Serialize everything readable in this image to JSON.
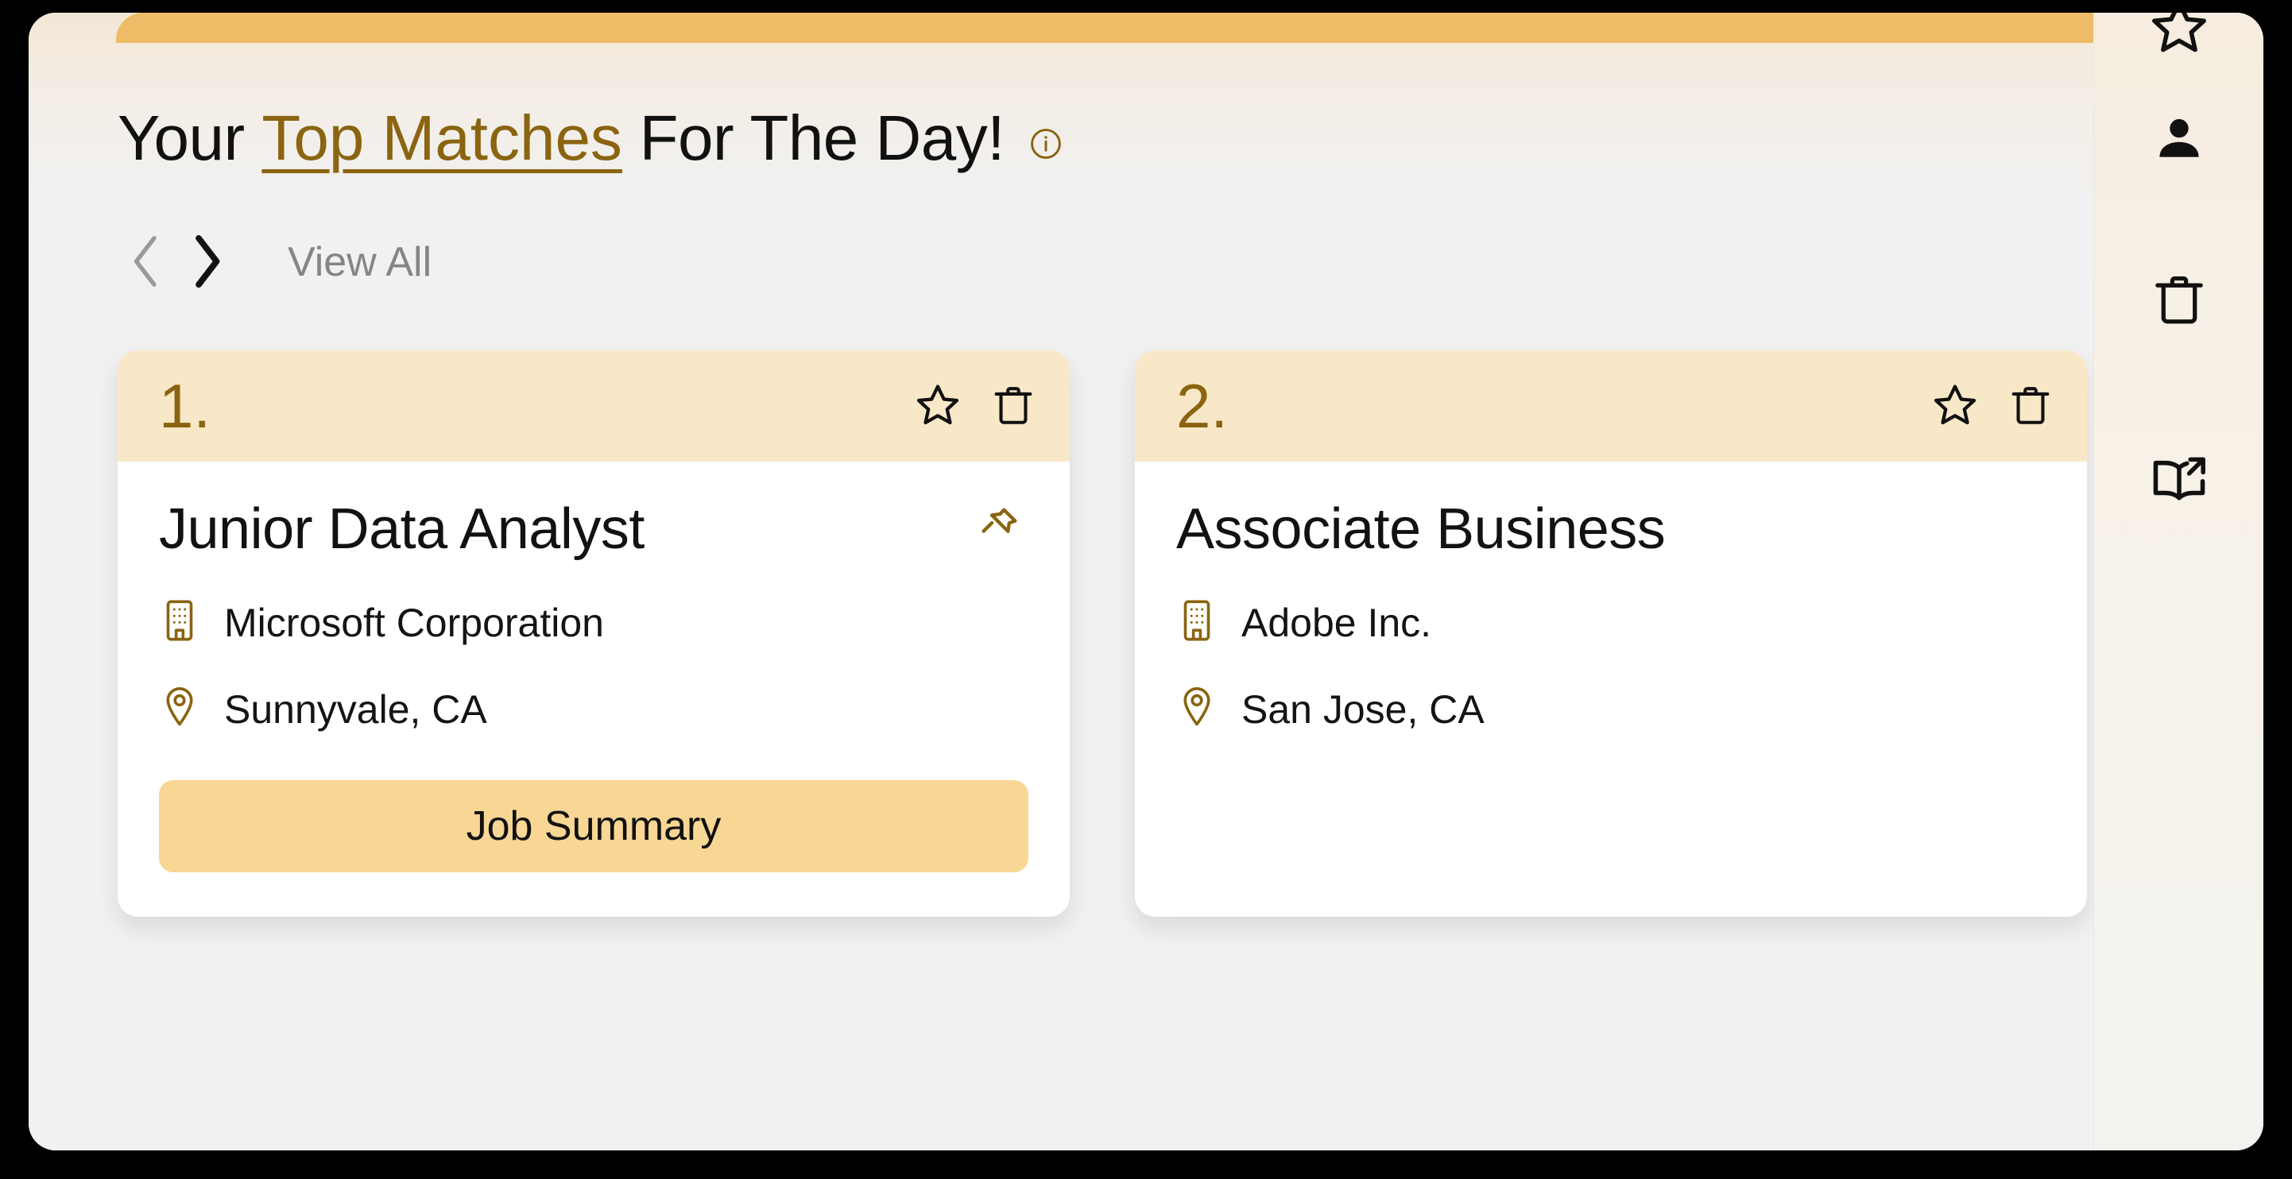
{
  "header": {
    "title_prefix": "Your ",
    "title_link": "Top Matches",
    "title_suffix": " For The Day!",
    "info_icon": "info-circle-icon"
  },
  "carousel": {
    "prev_icon": "chevron-left-icon",
    "prev_label": "‹",
    "next_icon": "chevron-right-icon",
    "next_label": "›",
    "view_all_label": "View All"
  },
  "cards": [
    {
      "rank": "1.",
      "title": "Junior Data Analyst",
      "company": "Microsoft Corporation",
      "location": "Sunnyvale, CA",
      "summary_button_label": "Job Summary",
      "favorite_icon": "star-outline-icon",
      "delete_icon": "trash-icon",
      "pin_icon": "pushpin-icon",
      "company_icon": "building-icon",
      "location_icon": "map-pin-icon"
    },
    {
      "rank": "2.",
      "title": "Associate Business",
      "company": "Adobe Inc.",
      "location": "San Jose, CA",
      "favorite_icon": "star-outline-icon",
      "delete_icon": "trash-icon",
      "company_icon": "building-icon",
      "location_icon": "map-pin-icon"
    }
  ],
  "sidebar": {
    "items": [
      {
        "icon": "star-outline-icon",
        "name": "favorites"
      },
      {
        "icon": "person-icon",
        "name": "profile"
      },
      {
        "icon": "trash-icon",
        "name": "trash"
      },
      {
        "icon": "book-open-share-icon",
        "name": "resources"
      }
    ]
  },
  "colors": {
    "accent_bar": "#eebc66",
    "brand_gold": "#8a6410",
    "card_header": "#f8e8c8",
    "summary_button": "#f8d694",
    "page_background": "#f1f1f1",
    "sidebar_background": "#f6ede0",
    "muted_text": "#858585"
  }
}
